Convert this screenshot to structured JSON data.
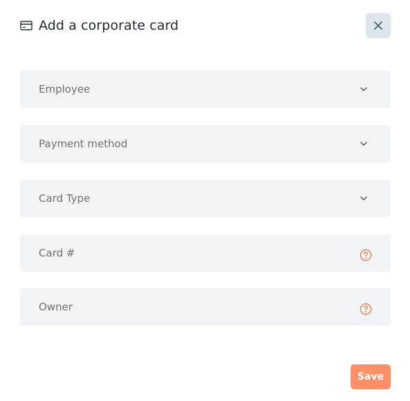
{
  "modal": {
    "title": "Add a corporate card",
    "title_icon": "credit-card-icon",
    "close_icon": "close-icon"
  },
  "fields": [
    {
      "label": "Employee",
      "icon": "chevron-down-icon"
    },
    {
      "label": "Payment method",
      "icon": "chevron-down-icon"
    },
    {
      "label": "Card Type",
      "icon": "chevron-down-icon"
    },
    {
      "label": "Card #",
      "icon": "help-circle-icon"
    },
    {
      "label": "Owner",
      "icon": "help-circle-icon"
    }
  ],
  "actions": {
    "save_label": "Save"
  },
  "colors": {
    "accent": "#ff8f66",
    "field_bg": "#f1f4f7",
    "close_bg": "#dde6ea",
    "help_icon": "#f07b4f"
  }
}
